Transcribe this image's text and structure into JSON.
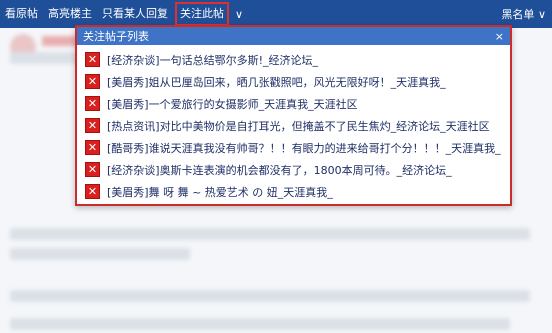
{
  "nav": {
    "items": [
      "看原帖",
      "高亮楼主",
      "只看某人回复",
      "关注此帖"
    ],
    "active_index": 3,
    "dropdown_arrow": "∨",
    "blacklist_label": "黑名单",
    "blacklist_arrow": "∨"
  },
  "popup": {
    "title": "关注帖子列表",
    "close": "×",
    "remove_label": "✕",
    "items": [
      "[经济杂谈]一句话总结鄂尔多斯!_经济论坛_",
      "[美眉秀]姐从巴厘岛回来，晒几张戳照吧，风光无限好呀！_天涯真我_",
      "[美眉秀]一个爱旅行的女摄影师_天涯真我_天涯社区",
      "[热点资讯]对比中美物价是自打耳光，但掩盖不了民生焦灼_经济论坛_天涯社区",
      "[酷哥秀]谁说天涯真我没有帅哥？！！有眼力的进来给哥打个分！！！_天涯真我_",
      "[经济杂谈]奥斯卡连表演的机会都没有了，1800本周可待。_经济论坛_",
      "[美眉秀]舞 呀 舞 ~ 热爱艺术 の 妞_天涯真我_"
    ]
  },
  "colors": {
    "topbar": "#1f4f98",
    "popup_header": "#3e73c6",
    "popup_border": "#cc2b2b",
    "remove_button": "#d9201f"
  }
}
